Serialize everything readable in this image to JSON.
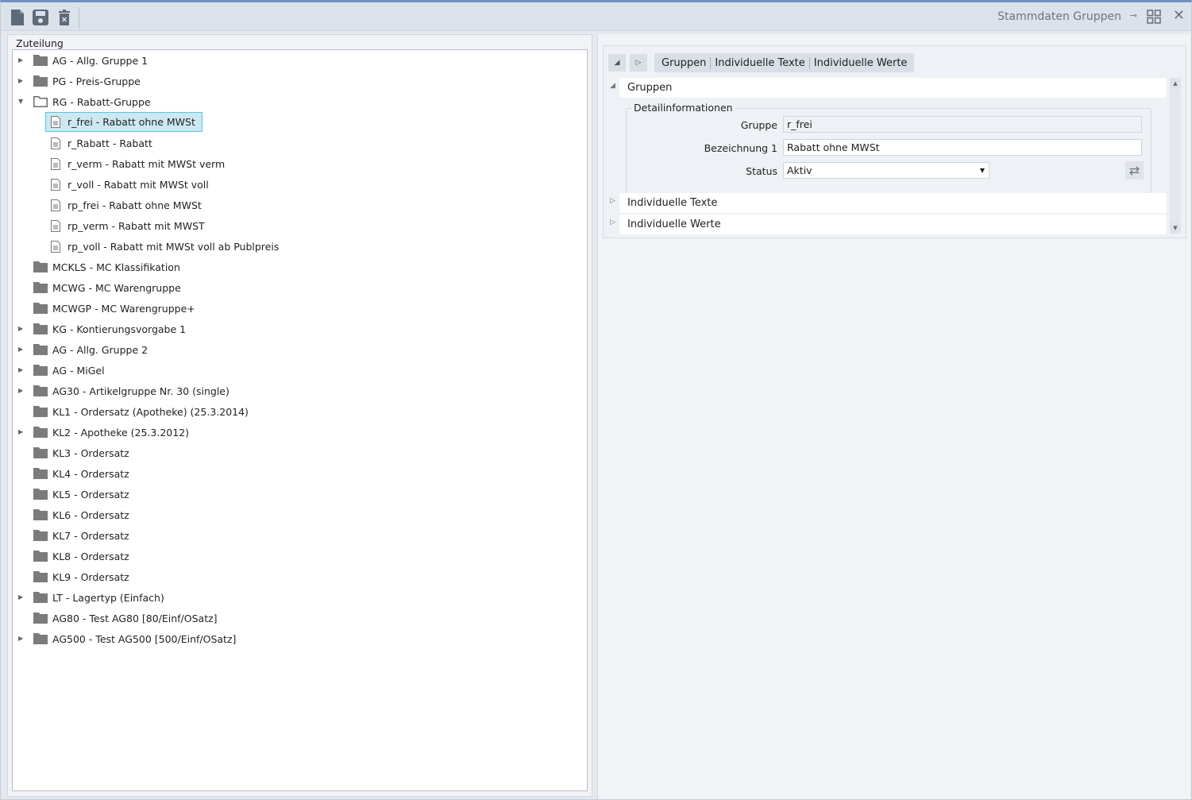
{
  "toolbar": {
    "title": "Stammdaten Gruppen"
  },
  "left": {
    "legend": "Zuteilung",
    "tree": [
      {
        "label": "AG - Allg. Gruppe 1",
        "type": "folder",
        "exp": "collapsed"
      },
      {
        "label": "PG - Preis-Gruppe",
        "type": "folder",
        "exp": "collapsed"
      },
      {
        "label": "RG - Rabatt-Gruppe",
        "type": "folder-open",
        "exp": "expanded"
      },
      {
        "label": "r_frei - Rabatt ohne MWSt",
        "type": "doc",
        "selected": true
      },
      {
        "label": "r_Rabatt - Rabatt",
        "type": "doc"
      },
      {
        "label": "r_verm - Rabatt mit MWSt verm",
        "type": "doc"
      },
      {
        "label": "r_voll - Rabatt mit MWSt voll",
        "type": "doc"
      },
      {
        "label": "rp_frei - Rabatt ohne MWSt",
        "type": "doc"
      },
      {
        "label": "rp_verm - Rabatt mit MWST",
        "type": "doc"
      },
      {
        "label": "rp_voll - Rabatt mit MWSt voll ab Publpreis",
        "type": "doc"
      },
      {
        "label": "MCKLS - MC Klassifikation",
        "type": "folder",
        "exp": "none"
      },
      {
        "label": "MCWG - MC Warengruppe",
        "type": "folder",
        "exp": "none"
      },
      {
        "label": "MCWGP - MC Warengruppe+",
        "type": "folder",
        "exp": "none"
      },
      {
        "label": "KG - Kontierungsvorgabe 1",
        "type": "folder",
        "exp": "collapsed"
      },
      {
        "label": "AG - Allg. Gruppe 2",
        "type": "folder",
        "exp": "collapsed"
      },
      {
        "label": "AG - MiGel",
        "type": "folder",
        "exp": "collapsed"
      },
      {
        "label": "AG30 - Artikelgruppe Nr. 30 (single)",
        "type": "folder",
        "exp": "collapsed"
      },
      {
        "label": "KL1 - Ordersatz (Apotheke) (25.3.2014)",
        "type": "folder",
        "exp": "none"
      },
      {
        "label": "KL2 - Apotheke (25.3.2012)",
        "type": "folder",
        "exp": "collapsed"
      },
      {
        "label": "KL3 - Ordersatz",
        "type": "folder",
        "exp": "none"
      },
      {
        "label": "KL4 - Ordersatz",
        "type": "folder",
        "exp": "none"
      },
      {
        "label": "KL5 - Ordersatz",
        "type": "folder",
        "exp": "none"
      },
      {
        "label": "KL6 - Ordersatz",
        "type": "folder",
        "exp": "none"
      },
      {
        "label": "KL7 - Ordersatz",
        "type": "folder",
        "exp": "none"
      },
      {
        "label": "KL8 - Ordersatz",
        "type": "folder",
        "exp": "none"
      },
      {
        "label": "KL9 - Ordersatz",
        "type": "folder",
        "exp": "none"
      },
      {
        "label": "LT - Lagertyp (Einfach)",
        "type": "folder",
        "exp": "collapsed"
      },
      {
        "label": "AG80 - Test AG80 [80/Einf/OSatz]",
        "type": "folder",
        "exp": "none"
      },
      {
        "label": "AG500 - Test AG500 [500/Einf/OSatz]",
        "type": "folder",
        "exp": "collapsed"
      }
    ]
  },
  "right": {
    "tabs": [
      "Gruppen",
      "Individuelle Texte",
      "Individuelle Werte"
    ],
    "sections": {
      "gruppen": "Gruppen",
      "texte": "Individuelle Texte",
      "werte": "Individuelle Werte"
    },
    "detail": {
      "legend": "Detailinformationen",
      "gruppe_label": "Gruppe",
      "gruppe_value": "r_frei",
      "bez_label": "Bezeichnung 1",
      "bez_value": "Rabatt ohne MWSt",
      "status_label": "Status",
      "status_value": "Aktiv"
    }
  }
}
